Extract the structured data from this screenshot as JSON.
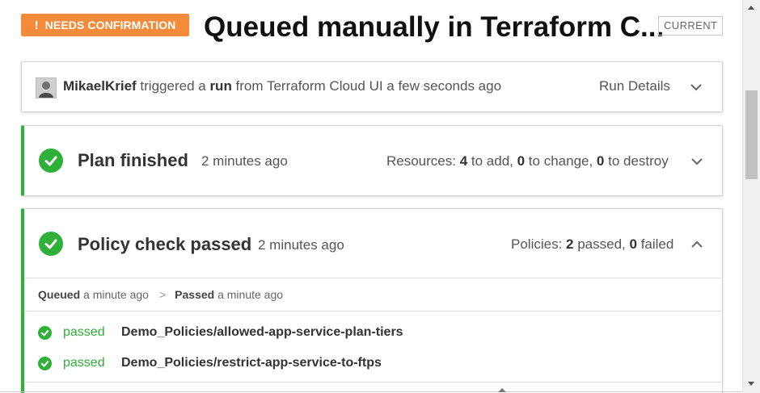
{
  "header": {
    "status_badge": "NEEDS CONFIRMATION",
    "badge_icon": "!",
    "title": "Queued manually in Terraform C...",
    "current_tag": "CURRENT",
    "badge_color": "#f48b3b"
  },
  "trigger": {
    "user": "MikaelKrief",
    "text1": " triggered a ",
    "run_word": "run",
    "text2": " from Terraform Cloud UI a few seconds ago",
    "run_details": "Run Details",
    "icons": {
      "avatar": "user-avatar",
      "expand": "chevron-down-icon"
    }
  },
  "plan": {
    "title": "Plan finished",
    "time": "2 minutes ago",
    "summary": {
      "prefix": "Resources: ",
      "add_count": "4",
      "add_text": " to add, ",
      "change_count": "0",
      "change_text": " to change, ",
      "destroy_count": "0",
      "destroy_text": " to destroy"
    },
    "accent_color": "#2eb039"
  },
  "policy": {
    "title": "Policy check passed",
    "time": "2 minutes ago",
    "summary": {
      "prefix": "Policies: ",
      "passed_count": "2",
      "passed_text": " passed, ",
      "failed_count": "0",
      "failed_text": " failed"
    },
    "timeline": {
      "queued_label": "Queued",
      "queued_time": " a minute ago",
      "separator": ">",
      "passed_label": "Passed",
      "passed_time": " a minute ago"
    },
    "results": [
      {
        "status": "passed",
        "name": "Demo_Policies/allowed-app-service-plan-tiers"
      },
      {
        "status": "passed",
        "name": "Demo_Policies/restrict-app-service-to-ftps"
      }
    ]
  }
}
